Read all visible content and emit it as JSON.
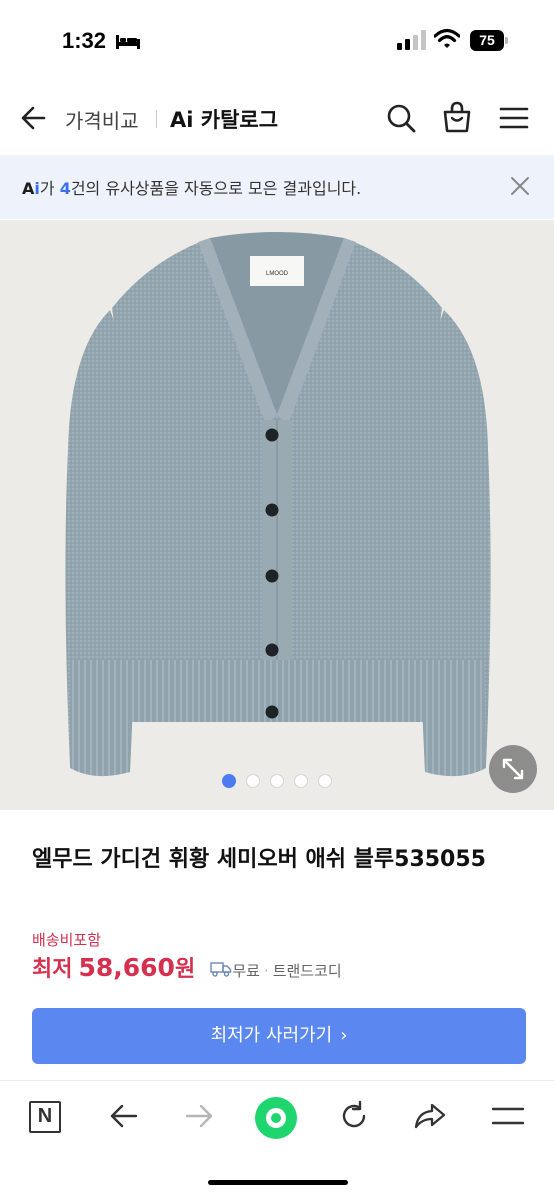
{
  "status": {
    "time": "1:32",
    "battery": "75"
  },
  "header": {
    "compare_label": "가격비교",
    "catalog_label": "Ai 카탈로그"
  },
  "ai_banner": {
    "logo_a": "A",
    "logo_i": "i",
    "text_ga": "가 ",
    "count": "4",
    "text_rest": "건의 유사상품을 자동으로 모은 결과입니다."
  },
  "gallery": {
    "page_count": 5,
    "current_page": 1
  },
  "product": {
    "title": "엘무드 가디건 휘황 세미오버 애쉬 블루535055",
    "shipping_note": "배송비포함",
    "price_label": "최저",
    "price": "58,660",
    "price_unit": "원",
    "free_shipping": "무료",
    "seller": "트랜드코디",
    "cta_label": "최저가 사러가기",
    "cta_chevron": "›"
  },
  "label_text": "LMOOD",
  "colors": {
    "accent": "#5b87f0",
    "price": "#d6304f",
    "banner_bg": "#eef2fb",
    "brand_green": "#1ed66d"
  },
  "icons": [
    "bed-icon",
    "signal-icon",
    "wifi-icon",
    "back-arrow-icon",
    "search-icon",
    "shopping-bag-icon",
    "menu-icon",
    "close-icon",
    "expand-icon",
    "truck-icon",
    "naver-n-icon",
    "back-icon",
    "forward-icon",
    "home-dot-icon",
    "refresh-icon",
    "share-icon",
    "menu-icon"
  ]
}
